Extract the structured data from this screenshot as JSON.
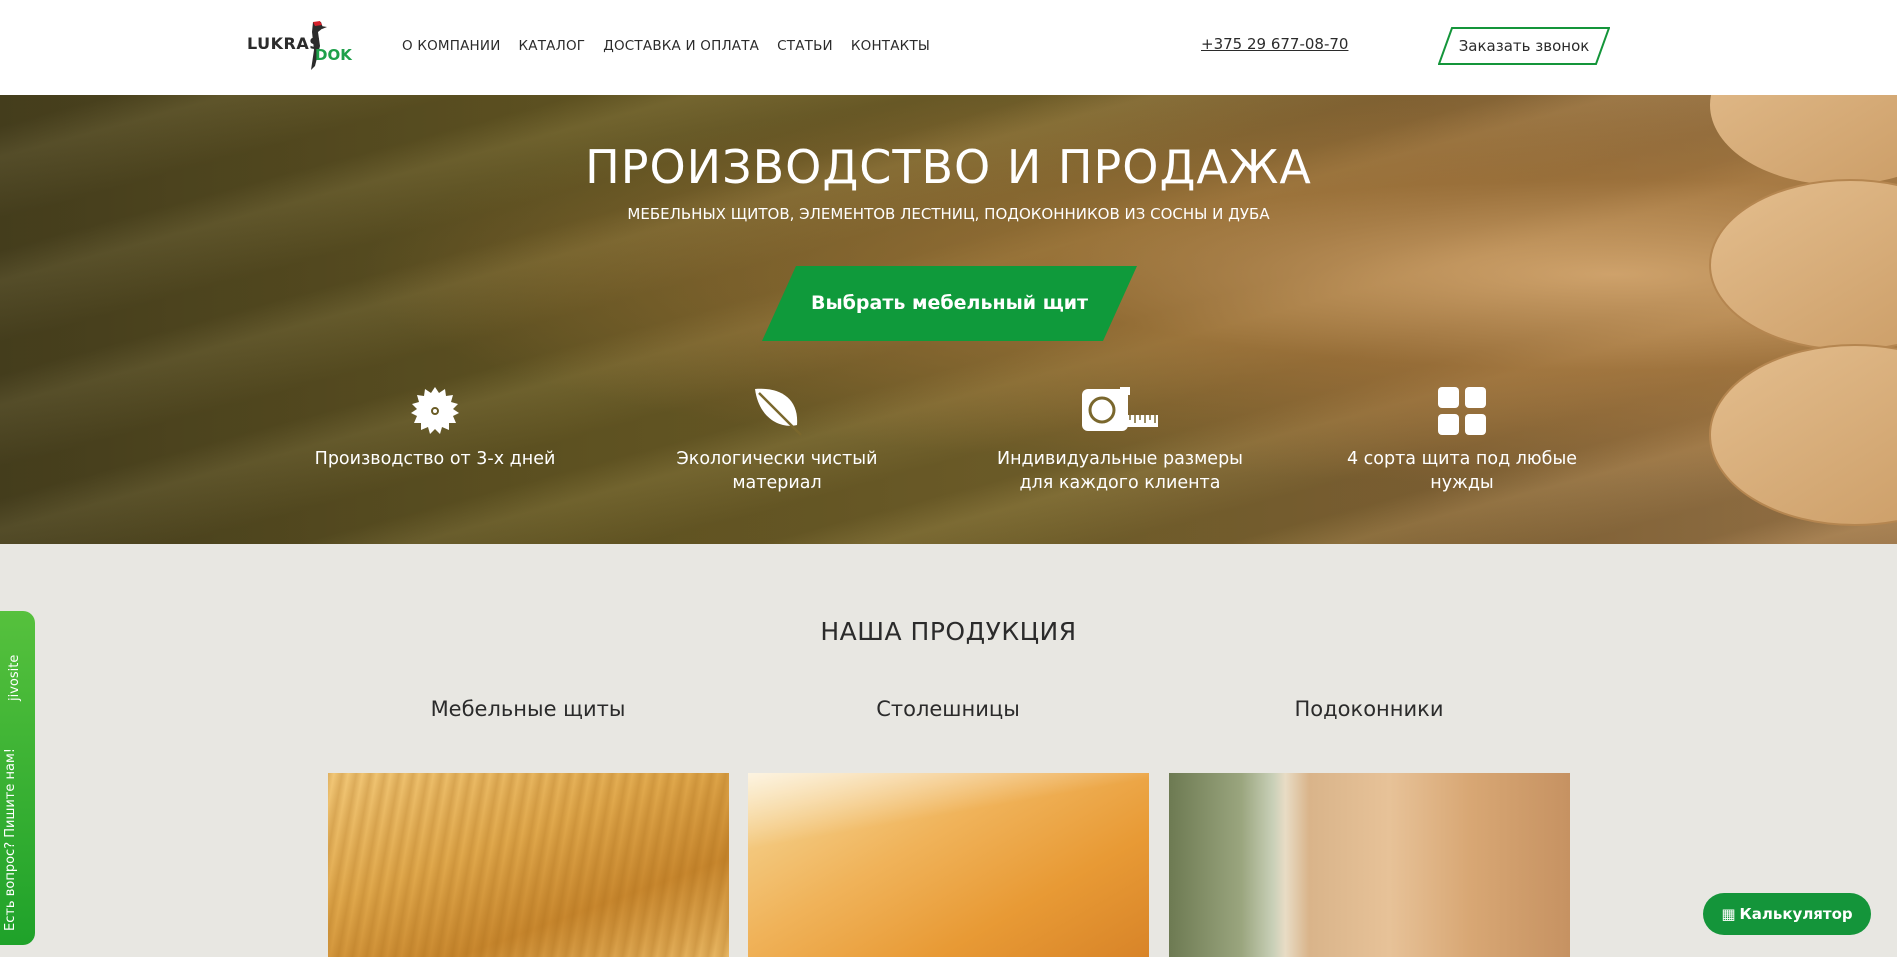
{
  "header": {
    "logo": {
      "brand_top": "LUKRAS",
      "brand_bottom": "DOK"
    },
    "nav": [
      {
        "label": "О КОМПАНИИ"
      },
      {
        "label": "КАТАЛОГ"
      },
      {
        "label": "ДОСТАВКА И ОПЛАТА"
      },
      {
        "label": "СТАТЬИ"
      },
      {
        "label": "КОНТАКТЫ"
      }
    ],
    "phone": "+375 29 677-08-70",
    "callback_label": "Заказать звонок"
  },
  "hero": {
    "title": "ПРОИЗВОДСТВО И ПРОДАЖА",
    "subtitle": "МЕБЕЛЬНЫХ ЩИТОВ, ЭЛЕМЕНТОВ ЛЕСТНИЦ, ПОДОКОННИКОВ ИЗ СОСНЫ И ДУБА",
    "cta_label": "Выбрать мебельный щит",
    "features": [
      {
        "icon": "saw-blade-icon",
        "text": "Производство от 3-х дней"
      },
      {
        "icon": "leaf-icon",
        "text": "Экологически чистый материал"
      },
      {
        "icon": "tape-measure-icon",
        "text": "Индивидуальные размеры для каждого клиента"
      },
      {
        "icon": "grid-icon",
        "text": "4 сорта щита под любые нужды"
      }
    ]
  },
  "products": {
    "title": "НАША ПРОДУКЦИЯ",
    "items": [
      {
        "name": "Мебельные щиты"
      },
      {
        "name": "Столешницы"
      },
      {
        "name": "Подоконники"
      }
    ]
  },
  "widgets": {
    "chat_label": "Есть вопрос? Пишите нам!",
    "chat_brand": "jivosite",
    "calculator_label": "Калькулятор",
    "calculator_icon": "calculator-icon"
  },
  "colors": {
    "accent_green": "#14953a",
    "chat_green": "#34b033",
    "background": "#e8e7e2"
  }
}
